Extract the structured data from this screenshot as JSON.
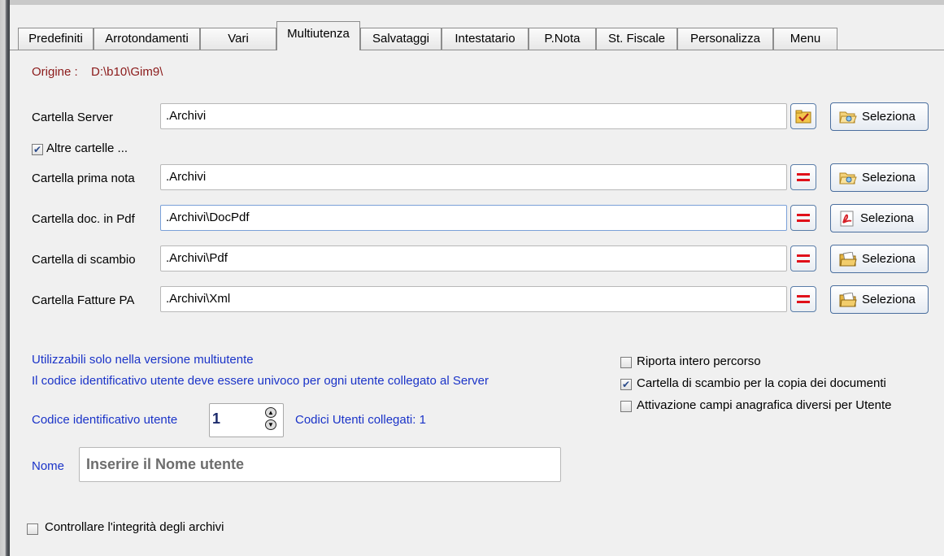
{
  "tabs": [
    "Predefiniti",
    "Arrotondamenti",
    "Vari",
    "Multiutenza",
    "Salvataggi",
    "Intestatario",
    "P.Nota",
    "St. Fiscale",
    "Personalizza",
    "Menu"
  ],
  "active_tab": "Multiutenza",
  "origin": {
    "label": "Origine :",
    "value": "D:\\b10\\Gim9\\"
  },
  "server": {
    "label": "Cartella Server",
    "value": ".Archivi",
    "select_label": "Seleziona"
  },
  "altre_cartelle": {
    "label": "Altre cartelle ...",
    "checked": true
  },
  "folders": [
    {
      "label": "Cartella prima nota",
      "value": ".Archivi",
      "select_label": "Seleziona",
      "icon": "folder-open-icon"
    },
    {
      "label": "Cartella doc. in Pdf",
      "value": ".Archivi\\DocPdf",
      "select_label": "Seleziona",
      "icon": "pdf-icon"
    },
    {
      "label": "Cartella di scambio",
      "value": ".Archivi\\Pdf",
      "select_label": "Seleziona",
      "icon": "folder-exchange-icon"
    },
    {
      "label": "Cartella Fatture PA",
      "value": ".Archivi\\Xml",
      "select_label": "Seleziona",
      "icon": "folder-exchange-icon"
    }
  ],
  "multiuser": {
    "info_line1": "Utilizzabili solo nella versione multiutente",
    "info_line2": "Il codice identificativo utente deve essere univoco per ogni utente collegato al Server",
    "code_label": "Codice identificativo utente",
    "code_value": "1",
    "connected_label": "Codici Utenti collegati: 1",
    "name_label": "Nome",
    "name_value": "Inserire il Nome utente"
  },
  "options": [
    {
      "label": "Riporta intero percorso",
      "checked": false
    },
    {
      "label": "Cartella di scambio per la copia dei documenti",
      "checked": true
    },
    {
      "label": "Attivazione campi anagrafica diversi per Utente",
      "checked": false
    }
  ],
  "integrity": {
    "label": "Controllare l'integrità degli archivi",
    "checked": false
  },
  "colors": {
    "link_blue": "#1a33c8",
    "origin_red": "#8b1a1a",
    "equal_red": "#e0101a"
  }
}
